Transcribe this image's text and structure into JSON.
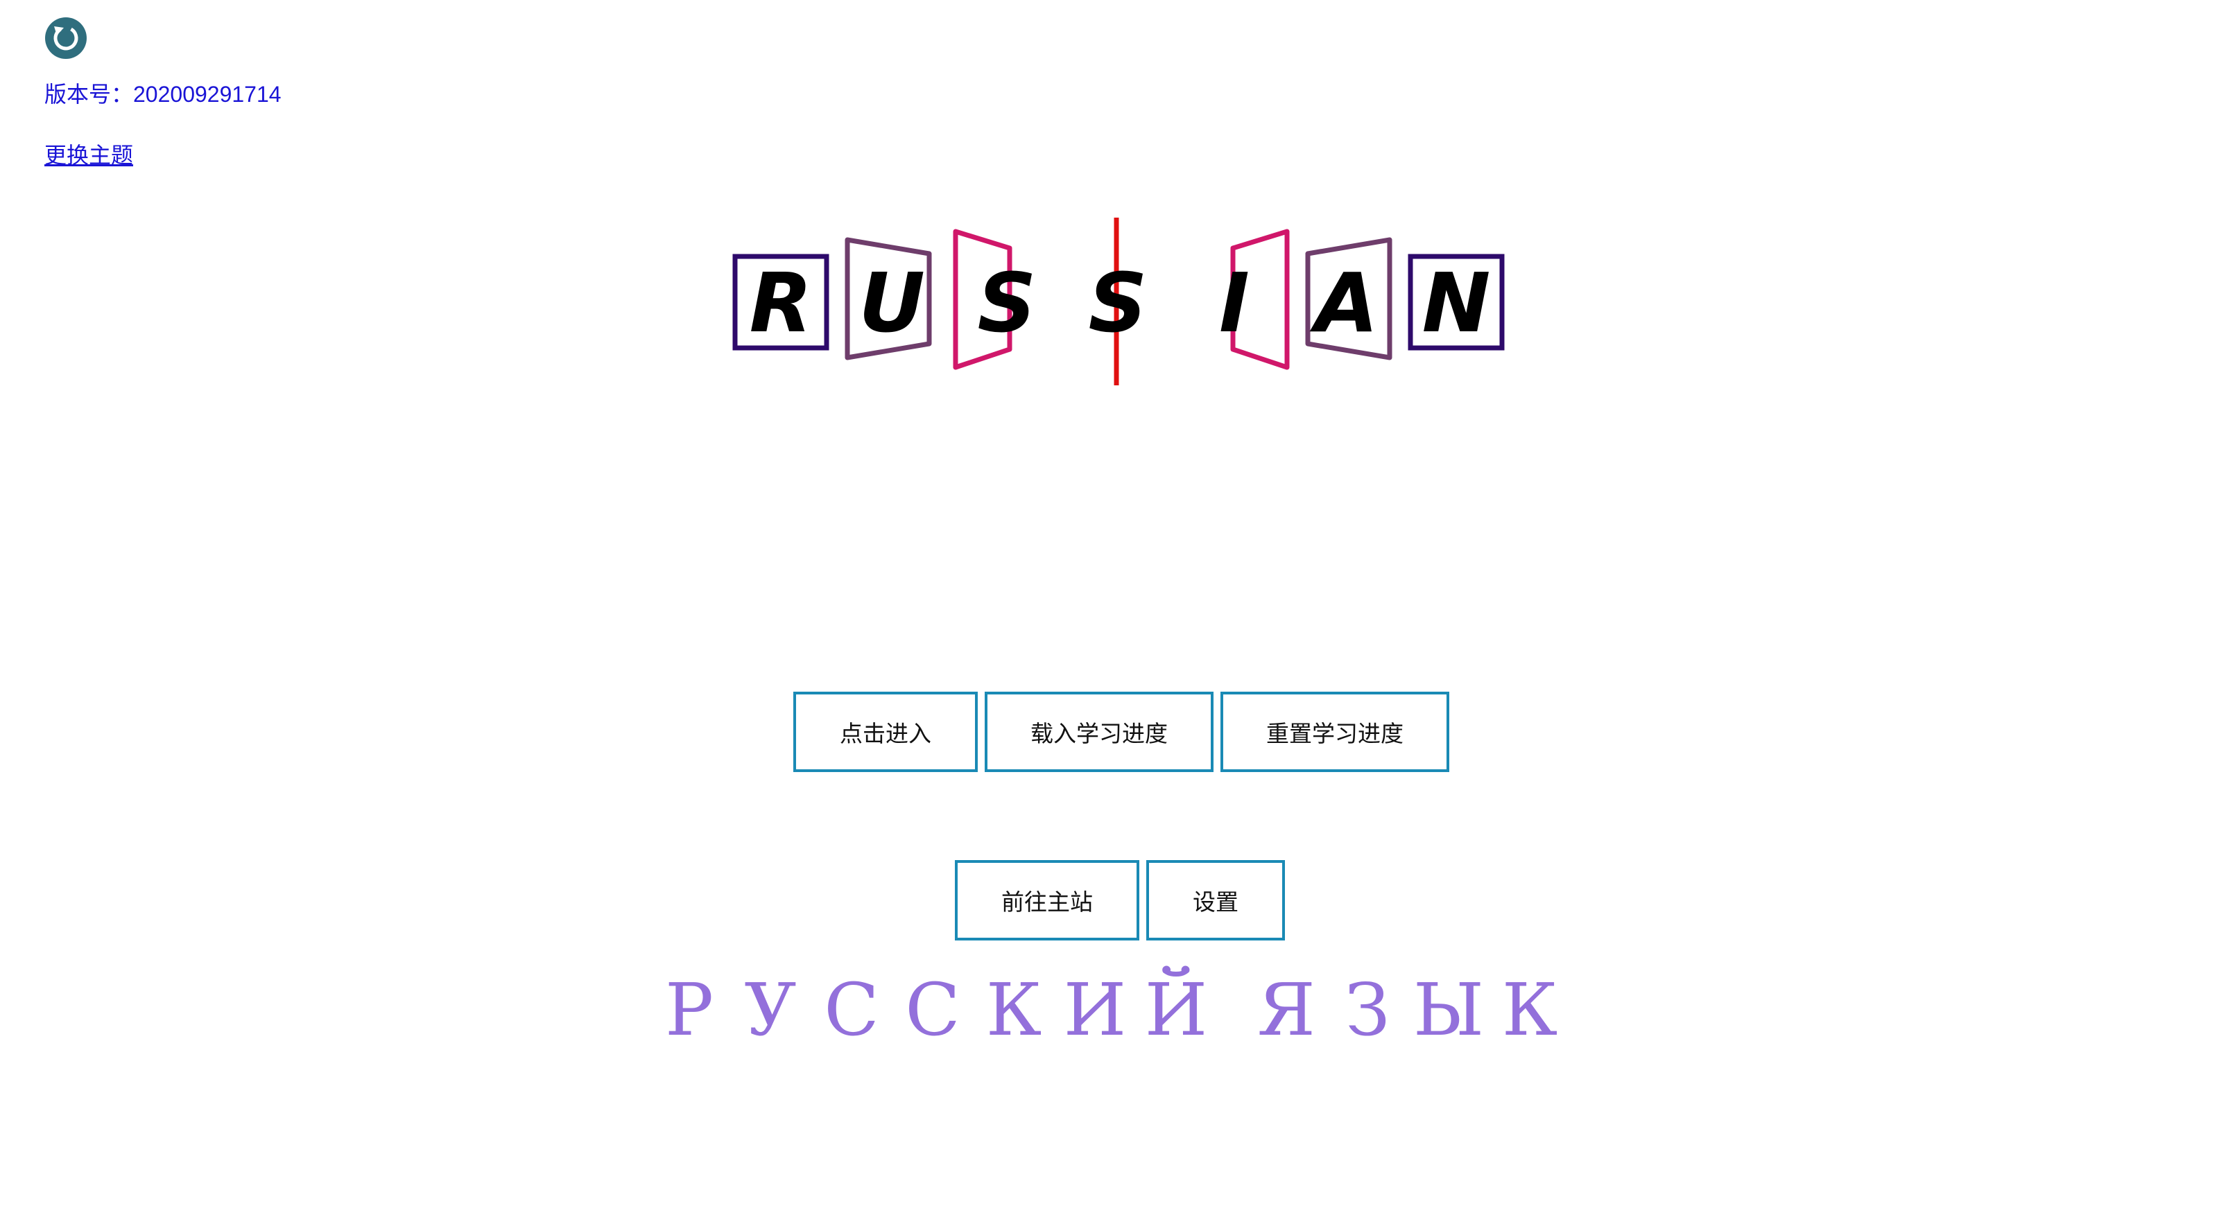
{
  "header": {
    "refresh_icon": "refresh-icon",
    "version_label": "版本号：202009291714",
    "theme_link": "更换主题"
  },
  "logo": {
    "letters": [
      "R",
      "U",
      "S",
      "S",
      "I",
      "A",
      "N"
    ],
    "colors": {
      "outer": "#2e0a6b",
      "middle": "#6e3d6b",
      "inner": "#d0176a",
      "divider": "#e01010"
    }
  },
  "buttons": {
    "enter": "点击进入",
    "load_progress": "载入学习进度",
    "reset_progress": "重置学习进度",
    "main_site": "前往主站",
    "settings": "设置"
  },
  "subtitle": {
    "word1": [
      "Р",
      "У",
      "С",
      "С",
      "К",
      "И",
      "Й"
    ],
    "word2": [
      "Я",
      "З",
      "Ы",
      "К"
    ],
    "color": "#9370db"
  }
}
